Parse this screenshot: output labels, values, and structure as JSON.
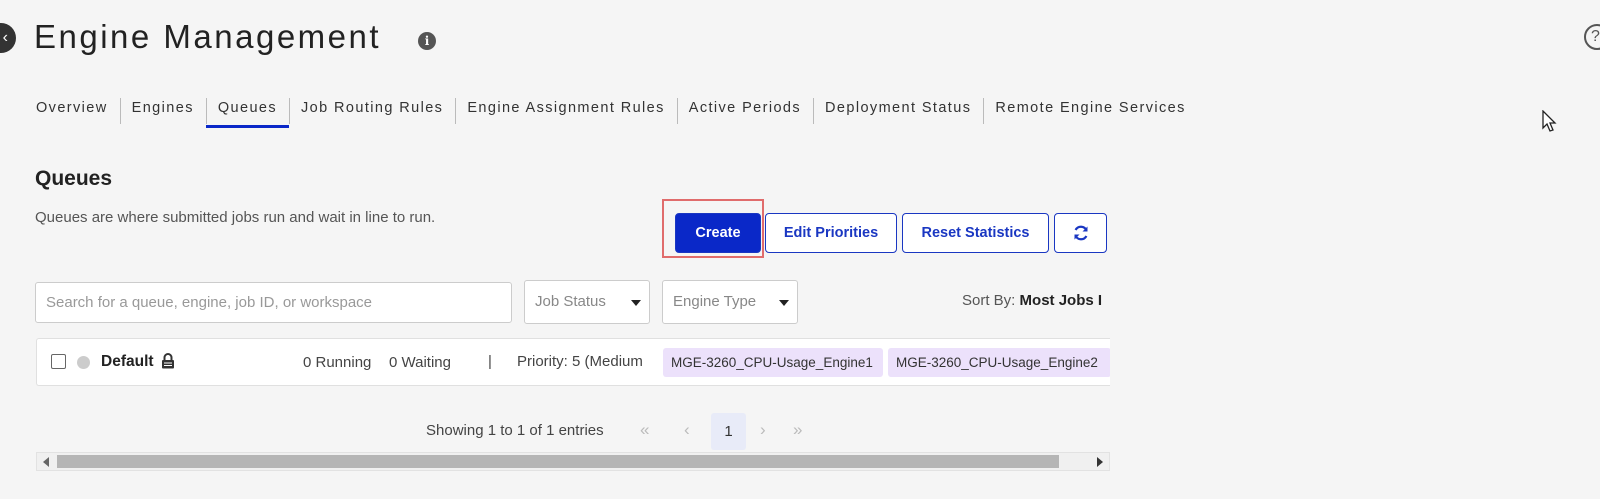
{
  "header": {
    "back_icon": "arrow-left-icon",
    "title": "Engine Management",
    "info_icon": "i",
    "help_icon": "?"
  },
  "tabs": [
    {
      "label": "Overview",
      "active": false
    },
    {
      "label": "Engines",
      "active": false
    },
    {
      "label": "Queues",
      "active": true
    },
    {
      "label": "Job Routing Rules",
      "active": false
    },
    {
      "label": "Engine Assignment Rules",
      "active": false
    },
    {
      "label": "Active Periods",
      "active": false
    },
    {
      "label": "Deployment Status",
      "active": false
    },
    {
      "label": "Remote Engine Services",
      "active": false
    }
  ],
  "section": {
    "title": "Queues",
    "description": "Queues are where submitted jobs run and wait in line to run."
  },
  "actions": {
    "create_label": "Create",
    "edit_priorities_label": "Edit Priorities",
    "reset_statistics_label": "Reset Statistics",
    "refresh_icon": "refresh-icon"
  },
  "filters": {
    "search_placeholder": "Search for a queue, engine, job ID, or workspace",
    "job_status_label": "Job Status",
    "engine_type_label": "Engine Type",
    "sort_by_label": "Sort By:",
    "sort_by_value": "Most Jobs I"
  },
  "queues": [
    {
      "name": "Default",
      "locked": true,
      "running": "0 Running",
      "waiting": "0 Waiting",
      "separator": "|",
      "priority": "Priority: 5 (Medium",
      "engines": [
        "MGE-3260_CPU-Usage_Engine1",
        "MGE-3260_CPU-Usage_Engine2"
      ]
    }
  ],
  "pagination": {
    "showing_text": "Showing 1 to 1 of 1 entries",
    "first": "«",
    "prev": "‹",
    "current_page": "1",
    "next": "›",
    "last": "»"
  },
  "colors": {
    "accent": "#0a28c8",
    "highlight_border": "#e06c6c",
    "engine_tag_bg": "#ece1fb",
    "status_dot": "#cccccc"
  }
}
